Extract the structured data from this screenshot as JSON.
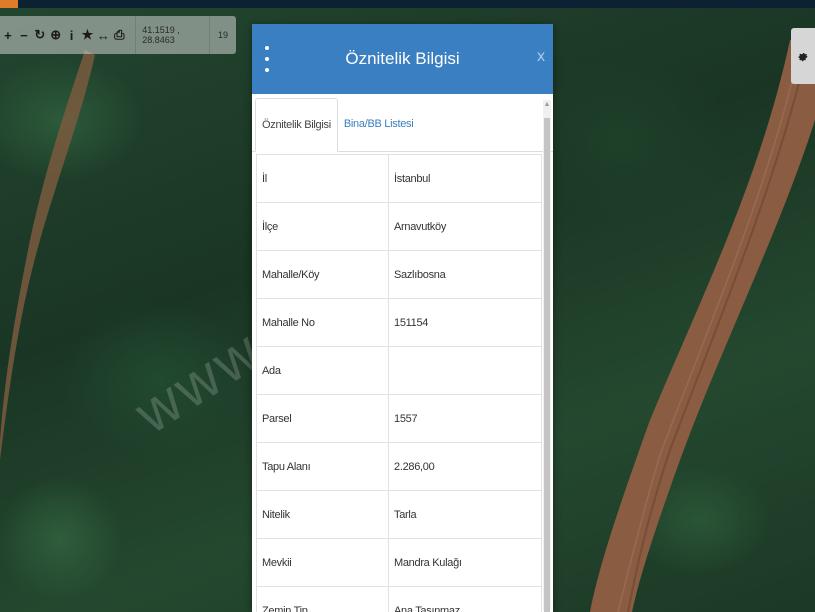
{
  "toolbar": {
    "tools": [
      {
        "name": "zoom-in-icon",
        "glyph": "+"
      },
      {
        "name": "zoom-out-icon",
        "glyph": "−"
      },
      {
        "name": "refresh-icon",
        "glyph": "↻"
      },
      {
        "name": "locate-icon",
        "glyph": "⊕"
      },
      {
        "name": "info-icon",
        "glyph": "i"
      },
      {
        "name": "favorite-star-icon",
        "glyph": "★"
      },
      {
        "name": "measure-icon",
        "glyph": "↔"
      },
      {
        "name": "print-icon",
        "glyph": "⎙"
      }
    ],
    "coordinates": "41.1519 , 28.8463",
    "zoom_level": "19"
  },
  "settings": {
    "icon": "gear-icon"
  },
  "watermark": "www.               e.net.tr",
  "panel": {
    "title": "Öznitelik Bilgisi",
    "close_label": "x",
    "tabs": [
      {
        "label": "Öznitelik Bilgisi",
        "active": true
      },
      {
        "label": "Bina/BB Listesi",
        "active": false
      }
    ],
    "rows": [
      {
        "key": "İl",
        "value": "İstanbul"
      },
      {
        "key": "İlçe",
        "value": "Arnavutköy"
      },
      {
        "key": "Mahalle/Köy",
        "value": "Sazlıbosna"
      },
      {
        "key": "Mahalle No",
        "value": "151154"
      },
      {
        "key": "Ada",
        "value": ""
      },
      {
        "key": "Parsel",
        "value": "1557"
      },
      {
        "key": "Tapu Alanı",
        "value": "2.286,00"
      },
      {
        "key": "Nitelik",
        "value": "Tarla"
      },
      {
        "key": "Mevkii",
        "value": "Mandra Kulağı"
      },
      {
        "key": "Zemin Tip",
        "value": "Ana Taşınmaz"
      }
    ]
  },
  "colors": {
    "header_blue": "#3a7fc1",
    "link_blue": "#3a7fc1",
    "accent_orange": "#e07b2a"
  }
}
